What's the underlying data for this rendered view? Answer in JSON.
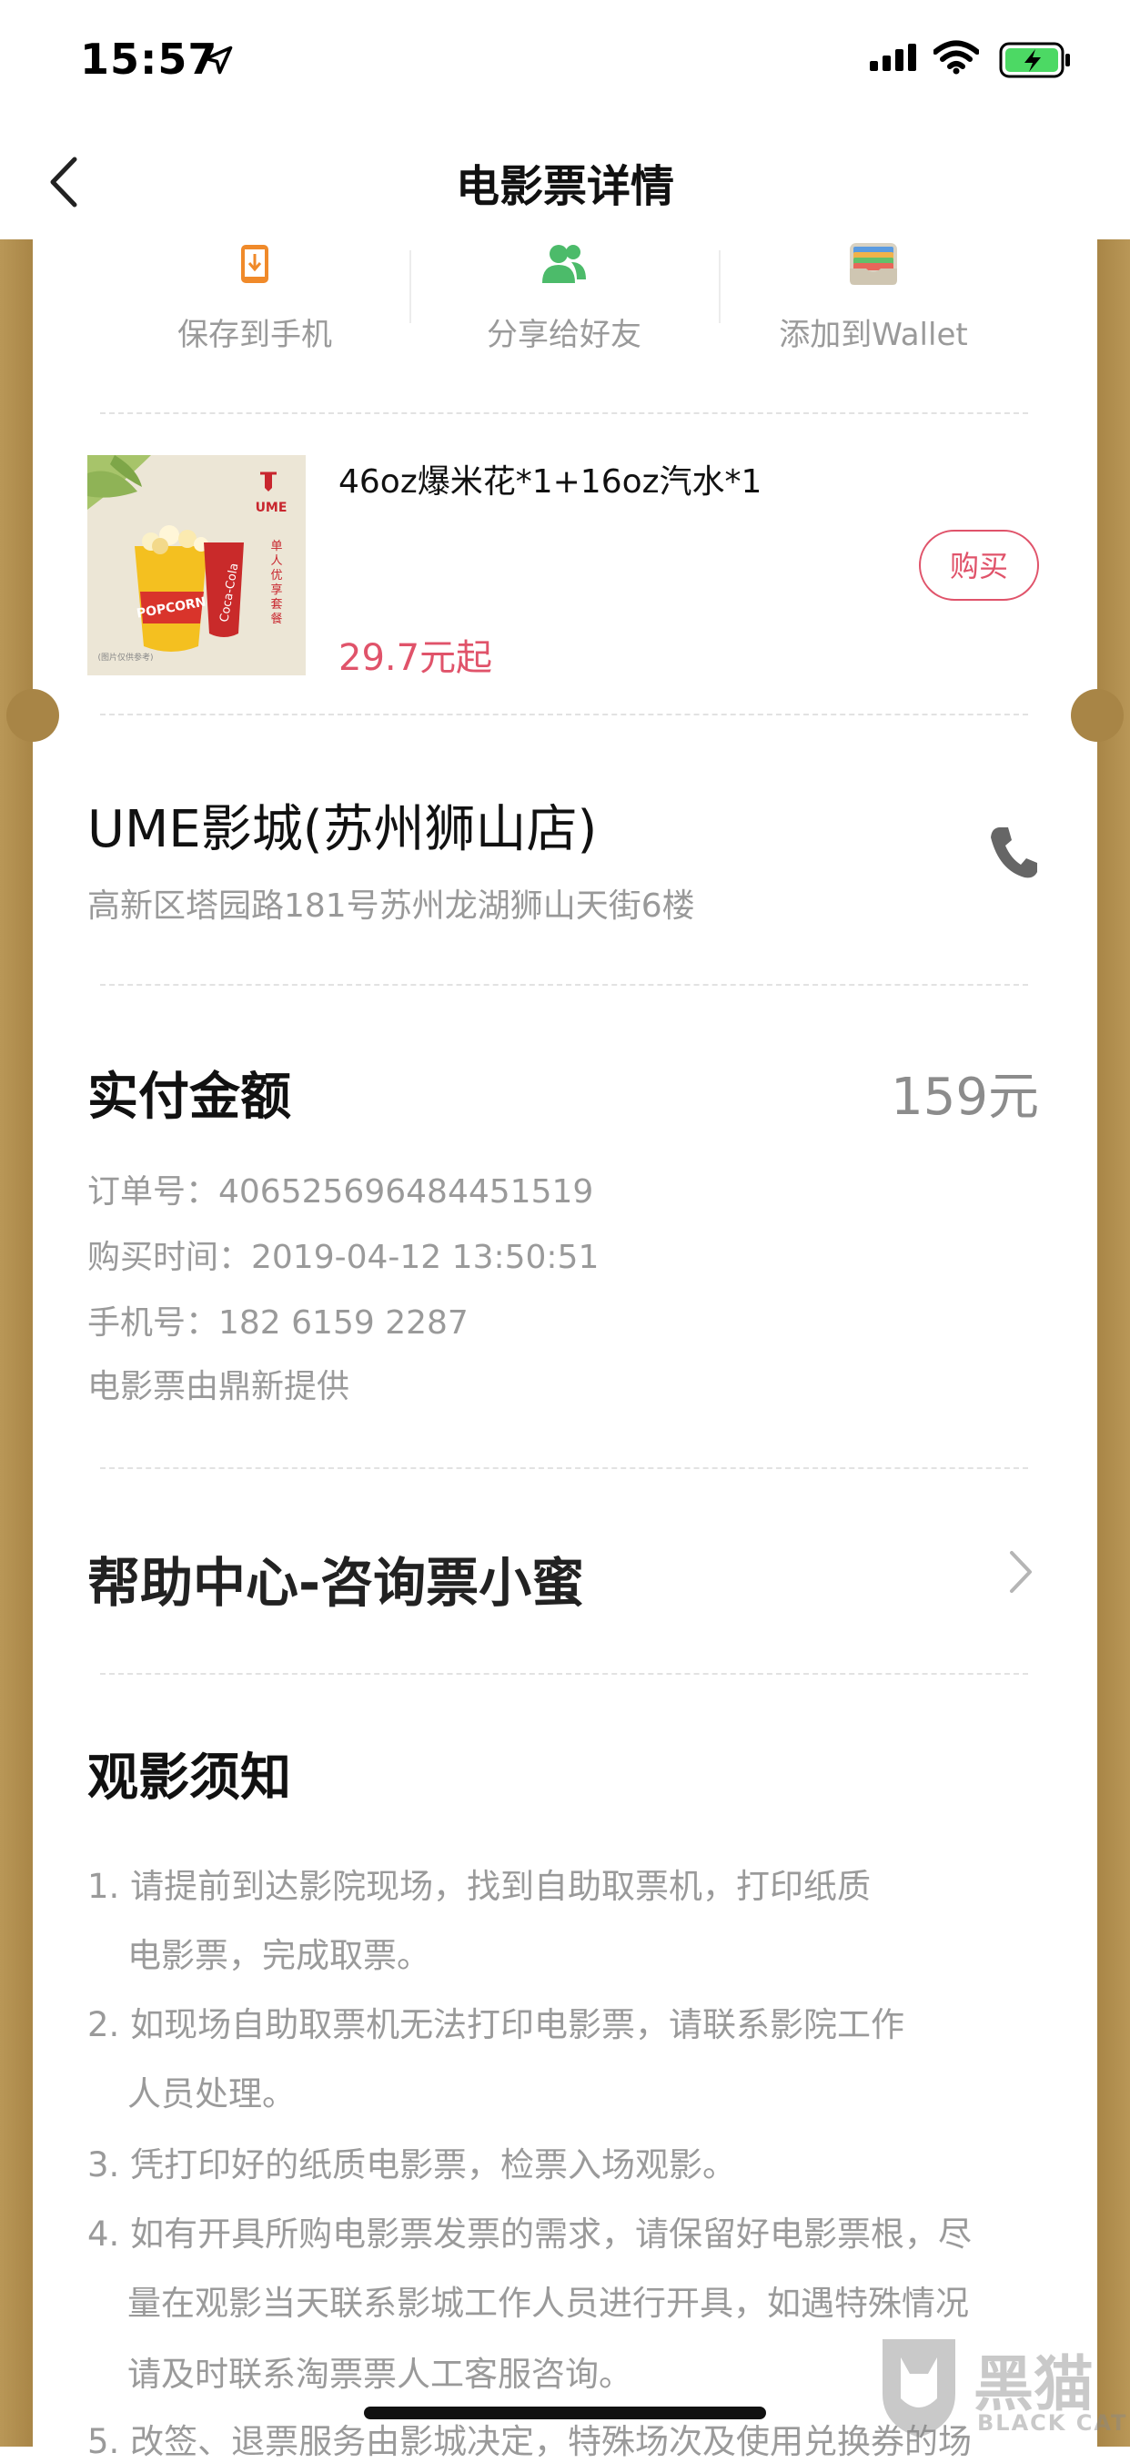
{
  "status_bar": {
    "time": "15:57"
  },
  "header": {
    "title": "电影票详情"
  },
  "actions": [
    {
      "label": "保存到手机",
      "icon": "phone-download-icon",
      "color": "#f08a2a"
    },
    {
      "label": "分享给好友",
      "icon": "users-icon",
      "color": "#4cbb6a"
    },
    {
      "label": "添加到Wallet",
      "icon": "wallet-icon"
    }
  ],
  "product": {
    "brand": "UME",
    "image_text": "单人优享套餐",
    "image_caption": "(图片仅供参考)",
    "name": "46oz爆米花*1+16oz汽水*1",
    "price": "29.7元起",
    "buy_label": "购买"
  },
  "cinema": {
    "name": "UME影城(苏州狮山店)",
    "address": "高新区塔园路181号苏州龙湖狮山天街6楼"
  },
  "payment": {
    "label": "实付金额",
    "amount": "159元",
    "order_no": "订单号：406525696484451519",
    "purchase_time": "购买时间：2019-04-12 13:50:51",
    "phone": "手机号：182 6159 2287",
    "provider": "电影票由鼎新提供"
  },
  "help": {
    "label": "帮助中心-咨询票小蜜"
  },
  "notice": {
    "title": "观影须知",
    "lines": [
      "1. 请提前到达影院现场，找到自助取票机，打印纸质",
      "电影票，完成取票。",
      "2. 如现场自助取票机无法打印电影票，请联系影院工作",
      "人员处理。",
      "3. 凭打印好的纸质电影票，检票入场观影。",
      "4. 如有开具所购电影票发票的需求，请保留好电影票根，尽",
      "量在观影当天联系影城工作人员进行开具，如遇特殊情况",
      "请及时联系淘票票人工客服咨询。",
      "5. 改签、退票服务由影城决定，特殊场次及使用兑换券的场"
    ]
  },
  "watermark": {
    "cn": "黑猫",
    "en": "BLACK CAT"
  },
  "colors": {
    "accent": "#e0536a",
    "frame_gold": "#a88546"
  }
}
